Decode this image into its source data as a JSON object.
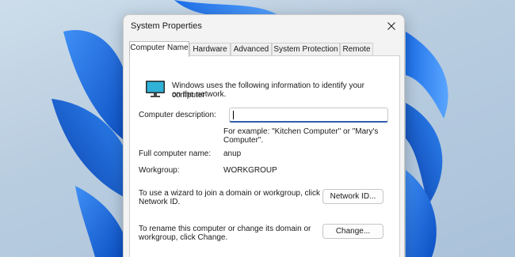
{
  "window": {
    "title": "System Properties"
  },
  "tabs": [
    {
      "label": "Computer Name",
      "active": true
    },
    {
      "label": "Hardware",
      "active": false
    },
    {
      "label": "Advanced",
      "active": false
    },
    {
      "label": "System Protection",
      "active": false
    },
    {
      "label": "Remote",
      "active": false
    }
  ],
  "panel": {
    "intro_line1": "Windows uses the following information to identify your computer",
    "intro_line2": "on the network.",
    "description_label": "Computer description:",
    "description_value": "",
    "example_line1": "For example: \"Kitchen Computer\" or \"Mary's",
    "example_line2": "Computer\".",
    "full_name_label": "Full computer name:",
    "full_name_value": "anup",
    "workgroup_label": "Workgroup:",
    "workgroup_value": "WORKGROUP",
    "wizard_line1": "To use a wizard to join a domain or workgroup, click",
    "wizard_line2": "Network ID.",
    "network_id_button": "Network ID...",
    "rename_line1": "To rename this computer or change its domain or",
    "rename_line2": "workgroup, click Change.",
    "change_button": "Change..."
  },
  "icons": {
    "close": "close-icon",
    "monitor": "computer-monitor-icon"
  },
  "colors": {
    "accent": "#2f5fa8",
    "wallpaper_blue": "#1a6fe0"
  }
}
